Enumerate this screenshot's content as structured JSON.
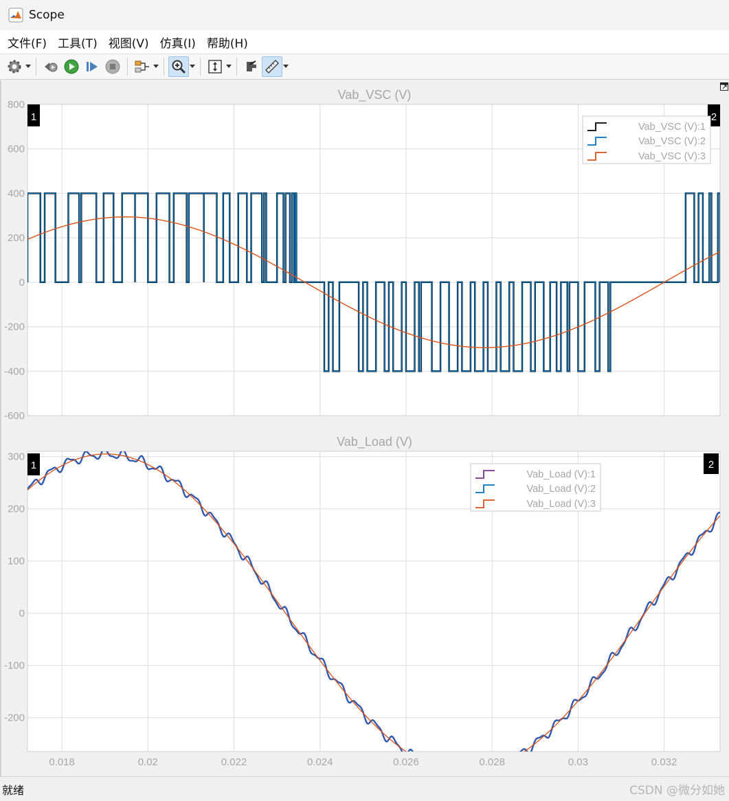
{
  "window": {
    "title": "Scope",
    "app_icon": "matlab-icon"
  },
  "menu": [
    {
      "label": "文件(F)"
    },
    {
      "label": "工具(T)"
    },
    {
      "label": "视图(V)"
    },
    {
      "label": "仿真(I)"
    },
    {
      "label": "帮助(H)"
    }
  ],
  "toolbar": [
    {
      "icon": "settings-gear-icon",
      "dropdown": true
    },
    {
      "icon": "step-back-icon",
      "dropdown": false
    },
    {
      "icon": "run-icon",
      "dropdown": false
    },
    {
      "icon": "step-forward-icon",
      "dropdown": false
    },
    {
      "icon": "stop-icon",
      "dropdown": false
    },
    {
      "icon": "signal-routing-icon",
      "dropdown": true
    },
    {
      "icon": "zoom-in-icon",
      "dropdown": true,
      "active": true
    },
    {
      "icon": "scale-axes-icon",
      "dropdown": true
    },
    {
      "icon": "highlight-simulink-block-icon",
      "dropdown": false
    },
    {
      "icon": "measurements-ruler-icon",
      "dropdown": true,
      "active": true
    }
  ],
  "status": {
    "text": "就绪"
  },
  "watermark": "CSDN @微分如她",
  "colors": {
    "series1_vsc": "#000000",
    "series1_load": "#7e2f8e",
    "series2": "#0072bd",
    "series3": "#d95319",
    "axis_text": "#a6a6a6",
    "grid": "#dcdcdc"
  },
  "chart_data": [
    {
      "type": "line",
      "title": "Vab_VSC (V)",
      "xlim": [
        0.0172,
        0.0333
      ],
      "ylim": [
        -600,
        800
      ],
      "yticks": [
        "800",
        "600",
        "400",
        "200",
        "0",
        "-200",
        "-400",
        "-600"
      ],
      "show_xtick_labels": false,
      "grid": true,
      "legend_position": "top-right",
      "channel_badges": [
        "1",
        "2"
      ],
      "series": [
        {
          "name": "Vab_VSC (V):1",
          "kind": "pwm",
          "positive_pulses": [
            [
              0.0172,
              0.0175
            ],
            [
              0.0176,
              0.01785
            ],
            [
              0.01815,
              0.0184
            ],
            [
              0.01845,
              0.0188
            ],
            [
              0.01897,
              0.0192
            ],
            [
              0.0194,
              0.0197
            ],
            [
              0.0197,
              0.02
            ],
            [
              0.0202,
              0.0205
            ],
            [
              0.0206,
              0.0209
            ],
            [
              0.02095,
              0.0213
            ],
            [
              0.0213,
              0.0216
            ],
            [
              0.02175,
              0.0219
            ],
            [
              0.0221,
              0.0223
            ],
            [
              0.0224,
              0.02265
            ],
            [
              0.0227,
              0.02275
            ],
            [
              0.023,
              0.02315
            ],
            [
              0.0232,
              0.0233
            ],
            [
              0.02335,
              0.0234
            ],
            [
              0.02343,
              0.02345
            ],
            [
              0.0325,
              0.02635
            ],
            [
              0.0326,
              0.0327
            ],
            [
              0.0328,
              0.0329
            ],
            [
              0.03305,
              0.0331
            ],
            [
              0.03325,
              0.0333
            ]
          ],
          "negative_pulses": [
            [
              0.0241,
              0.0242
            ],
            [
              0.0243,
              0.02445
            ],
            [
              0.0244,
              0.0245
            ],
            [
              0.0249,
              0.025
            ],
            [
              0.0251,
              0.0253
            ],
            [
              0.0252,
              0.0254
            ],
            [
              0.0255,
              0.0256
            ],
            [
              0.0257,
              0.0259
            ],
            [
              0.026,
              0.0262
            ],
            [
              0.0263,
              0.0265
            ],
            [
              0.0266,
              0.0268
            ],
            [
              0.027,
              0.0272
            ],
            [
              0.0273,
              0.0275
            ],
            [
              0.0276,
              0.0278
            ],
            [
              0.0279,
              0.0281
            ],
            [
              0.0282,
              0.0284
            ],
            [
              0.0285,
              0.0287
            ],
            [
              0.0289,
              0.029
            ],
            [
              0.0292,
              0.02935
            ],
            [
              0.0295,
              0.0296
            ],
            [
              0.02975,
              0.0298
            ],
            [
              0.03,
              0.03015
            ],
            [
              0.0304,
              0.0305
            ],
            [
              0.0307,
              0.03075
            ]
          ],
          "levels": [
            0,
            400
          ]
        },
        {
          "name": "Vab_VSC (V):2",
          "kind": "pwm_copy_of_1"
        },
        {
          "name": "Vab_VSC (V):3",
          "kind": "sine",
          "amplitude": 294,
          "zero_crossing_down": 0.02365,
          "period": 0.0167
        }
      ]
    },
    {
      "type": "line",
      "title": "Vab_Load (V)",
      "xlim": [
        0.0172,
        0.0333
      ],
      "ylim": [
        -265,
        310
      ],
      "yticks": [
        "300",
        "200",
        "100",
        "0",
        "-100",
        "-200"
      ],
      "xtick_labels": [
        "0.018",
        "0.02",
        "0.022",
        "0.024",
        "0.026",
        "0.028",
        "0.03",
        "0.032"
      ],
      "xticks": [
        0.018,
        0.02,
        0.022,
        0.024,
        0.026,
        0.028,
        0.03,
        0.032
      ],
      "grid": true,
      "legend_position": "top-right",
      "channel_badges": [
        "1",
        "2"
      ],
      "series": [
        {
          "name": "Vab_Load (V):1",
          "kind": "sine_with_ripple",
          "amplitude": 305,
          "zero_crossing_down": 0.0232,
          "period": 0.0167,
          "ripple_amplitude": 8,
          "ripple_period": 0.00042
        },
        {
          "name": "Vab_Load (V):2",
          "kind": "copy_of_1"
        },
        {
          "name": "Vab_Load (V):3",
          "kind": "sine",
          "amplitude": 305,
          "zero_crossing_down": 0.0232,
          "period": 0.0167
        }
      ]
    }
  ]
}
